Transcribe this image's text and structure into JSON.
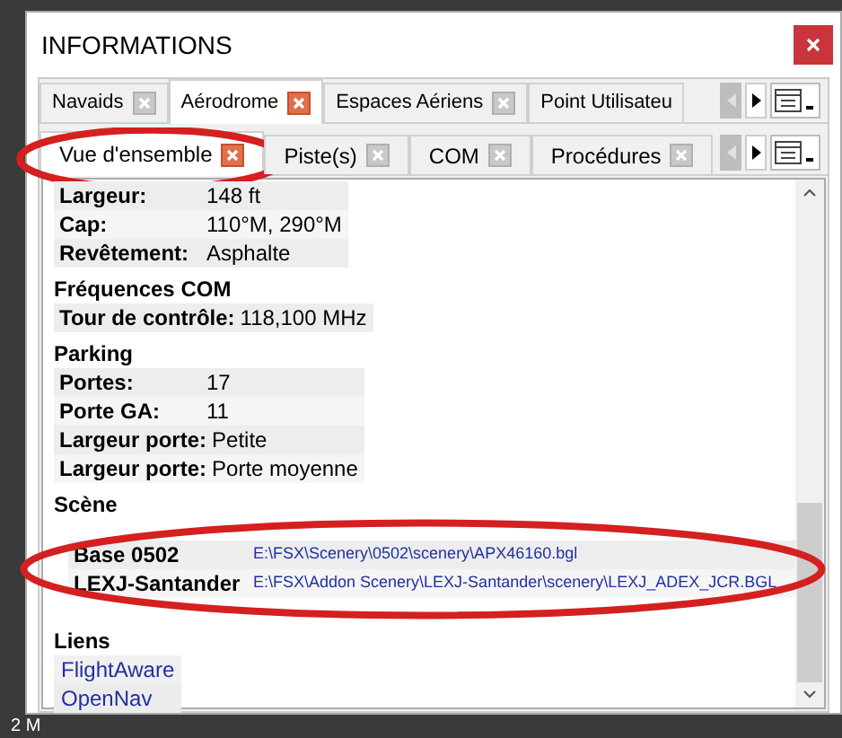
{
  "window": {
    "title": "INFORMATIONS"
  },
  "tabs": [
    {
      "label": "Navaids",
      "selected": false,
      "closable": true
    },
    {
      "label": "Aérodrome",
      "selected": true,
      "closable": true
    },
    {
      "label": "Espaces Aériens",
      "selected": false,
      "closable": true
    },
    {
      "label": "Point Utilisateu",
      "selected": false,
      "closable": false
    }
  ],
  "subtabs": [
    {
      "label": "Vue d'ensemble",
      "selected": true,
      "circled": true
    },
    {
      "label": "Piste(s)",
      "selected": false,
      "circled": false
    },
    {
      "label": "COM",
      "selected": false,
      "circled": false
    },
    {
      "label": "Procédures",
      "selected": false,
      "circled": false
    }
  ],
  "sections": [
    {
      "rows": [
        {
          "label": "Largeur:",
          "value": "148 ft"
        },
        {
          "label": "Cap:",
          "value": "110°M, 290°M"
        },
        {
          "label": "Revêtement:",
          "value": "Asphalte"
        }
      ]
    },
    {
      "title": "Fréquences COM",
      "rows": [
        {
          "label": "Tour de contrôle:",
          "value": "118,100 MHz"
        }
      ]
    },
    {
      "title": "Parking",
      "rows": [
        {
          "label": "Portes:",
          "value": "17"
        },
        {
          "label": "Porte GA:",
          "value": "11"
        },
        {
          "label": "Largeur porte:",
          "value": "Petite"
        },
        {
          "label": "Largeur porte:",
          "value": "Porte moyenne"
        }
      ]
    },
    {
      "title": "Scène",
      "circled": true,
      "rows": [
        {
          "label": "Base 0502",
          "value": "E:\\FSX\\Scenery\\0502\\scenery\\APX46160.bgl",
          "kind": "path"
        },
        {
          "label": "LEXJ-Santander",
          "value": "E:\\FSX\\Addon Scenery\\LEXJ-Santander\\scenery\\LEXJ_ADEX_JCR.BGL",
          "kind": "path"
        }
      ]
    },
    {
      "title": "Liens",
      "links": [
        "FlightAware",
        "OpenNav"
      ]
    }
  ],
  "status_bar": {
    "text": "2 M"
  }
}
